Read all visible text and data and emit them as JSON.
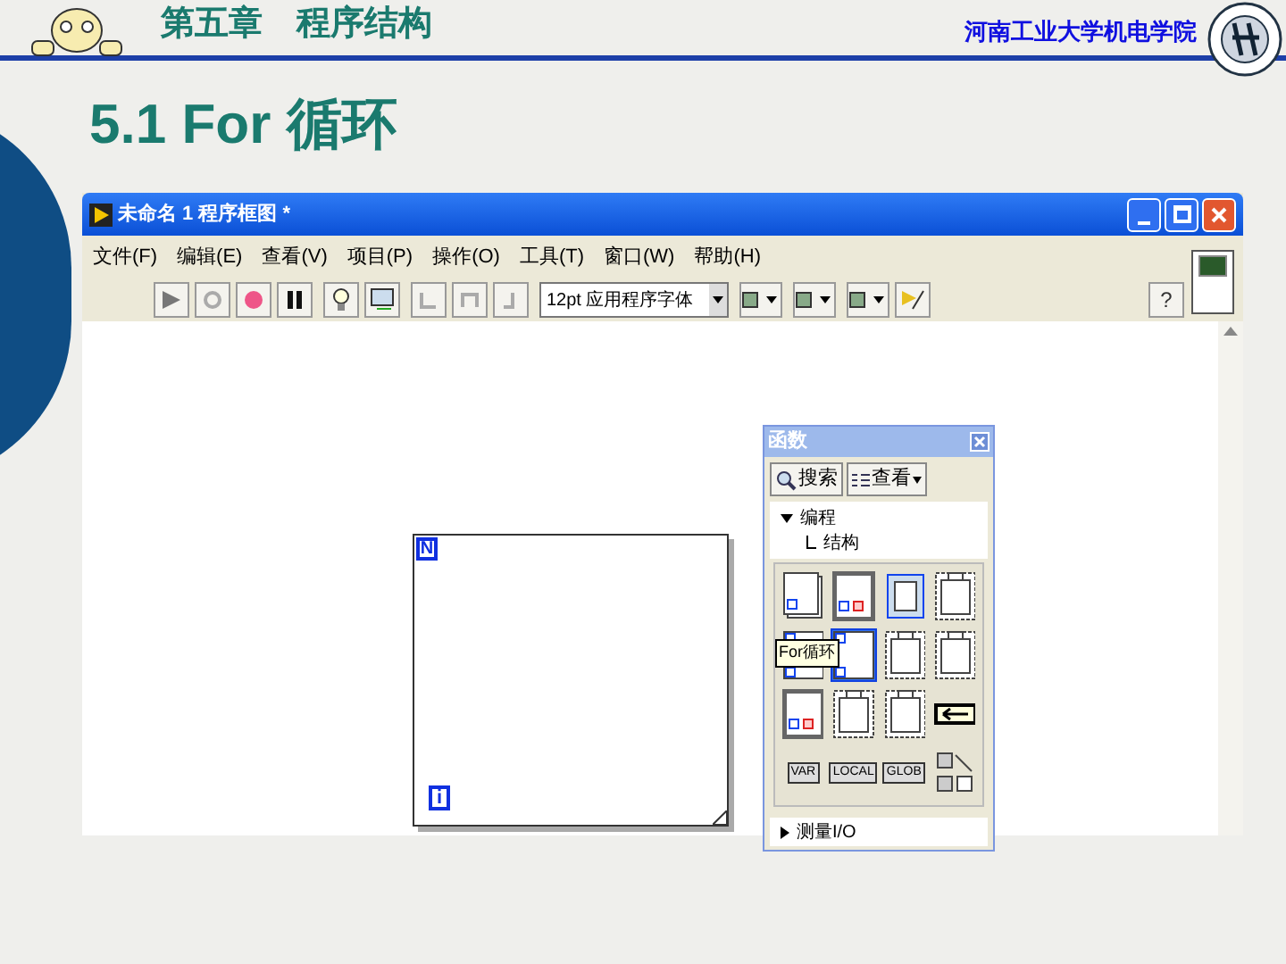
{
  "header": {
    "chapter": "第五章　程序结构",
    "school": "河南工业大学机电学院"
  },
  "slide_title": "5.1 For 循环",
  "window": {
    "title": "未命名 1 程序框图 *",
    "menu": [
      "文件(F)",
      "编辑(E)",
      "查看(V)",
      "项目(P)",
      "操作(O)",
      "工具(T)",
      "窗口(W)",
      "帮助(H)"
    ],
    "font_select": "12pt 应用程序字体",
    "help_button": "?",
    "canvas": {
      "for_loop": {
        "count_terminal": "N",
        "index_terminal": "i"
      }
    },
    "palette": {
      "title": "函数",
      "search_button": "搜索",
      "view_button": "查看",
      "tree": [
        {
          "label": "编程",
          "expanded": true,
          "children": [
            {
              "label": "结构"
            }
          ]
        }
      ],
      "items": [
        {
          "kind": "stack",
          "selected": false
        },
        {
          "kind": "case",
          "selected": false
        },
        {
          "kind": "event",
          "selected": false
        },
        {
          "kind": "film",
          "selected": false
        },
        {
          "kind": "loop",
          "selected": false
        },
        {
          "kind": "loop",
          "selected": true
        },
        {
          "kind": "film",
          "selected": false
        },
        {
          "kind": "film",
          "selected": false
        },
        {
          "kind": "case",
          "selected": false
        },
        {
          "kind": "film",
          "selected": false
        },
        {
          "kind": "film",
          "selected": false
        },
        {
          "kind": "arrow",
          "selected": false
        },
        {
          "kind": "label",
          "text": "VAR",
          "selected": false
        },
        {
          "kind": "label",
          "text": "LOCAL",
          "selected": false
        },
        {
          "kind": "label",
          "text": "GLOB",
          "selected": false
        },
        {
          "kind": "more",
          "selected": false
        }
      ],
      "tooltip": "For循环",
      "collapsed": [
        {
          "label": "测量I/O",
          "expanded": false
        }
      ]
    }
  }
}
